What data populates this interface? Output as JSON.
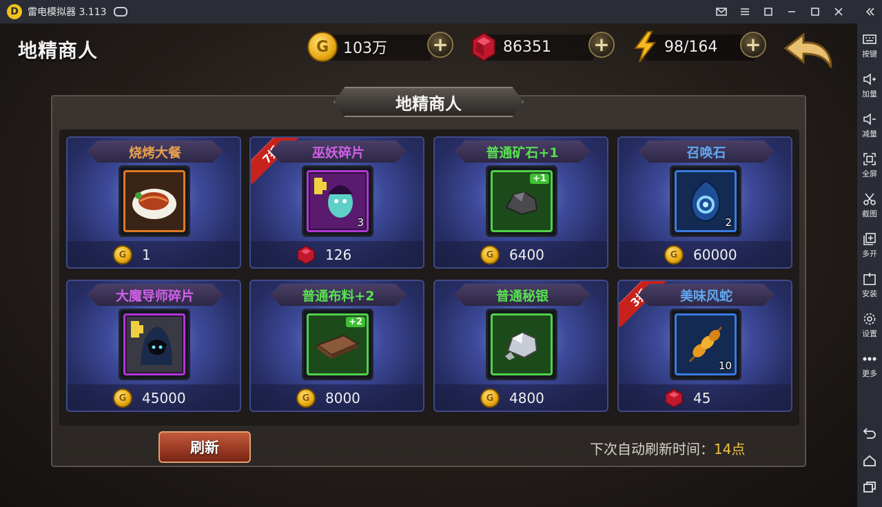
{
  "emulator": {
    "title": "雷电模拟器 3.113",
    "sidebar": [
      {
        "label": "按键",
        "icon": "keyboard-icon"
      },
      {
        "label": "加量",
        "icon": "volume-up-icon"
      },
      {
        "label": "减量",
        "icon": "volume-down-icon"
      },
      {
        "label": "全屏",
        "icon": "fullscreen-icon"
      },
      {
        "label": "截图",
        "icon": "scissors-icon"
      },
      {
        "label": "多开",
        "icon": "multi-open-icon"
      },
      {
        "label": "安装",
        "icon": "apk-install-icon"
      },
      {
        "label": "设置",
        "icon": "gear-icon"
      },
      {
        "label": "更多",
        "icon": "more-icon"
      }
    ]
  },
  "game": {
    "page_title": "地精商人",
    "resources": {
      "gold": "103万",
      "gems": "86351",
      "energy": "98/164"
    },
    "panel_title": "地精商人",
    "items": [
      {
        "name": "烧烤大餐",
        "name_color": "#e8a050",
        "frame": "orange",
        "price": "1",
        "currency": "gold",
        "qty": "",
        "plus": "",
        "discount": ""
      },
      {
        "name": "巫妖碎片",
        "name_color": "#d060e8",
        "frame": "purple",
        "price": "126",
        "currency": "gem",
        "qty": "3",
        "plus": "",
        "discount": "7折"
      },
      {
        "name": "普通矿石+1",
        "name_color": "#58e050",
        "frame": "green",
        "price": "6400",
        "currency": "gold",
        "qty": "",
        "plus": "+1",
        "discount": ""
      },
      {
        "name": "召唤石",
        "name_color": "#60a8f0",
        "frame": "blue",
        "price": "60000",
        "currency": "gold",
        "qty": "2",
        "plus": "",
        "discount": ""
      },
      {
        "name": "大魔导师碎片",
        "name_color": "#d060e8",
        "frame": "purple",
        "price": "45000",
        "currency": "gold",
        "qty": "",
        "plus": "",
        "discount": ""
      },
      {
        "name": "普通布料+2",
        "name_color": "#58e050",
        "frame": "green",
        "price": "8000",
        "currency": "gold",
        "qty": "",
        "plus": "+2",
        "discount": ""
      },
      {
        "name": "普通秘银",
        "name_color": "#58e050",
        "frame": "green",
        "price": "4800",
        "currency": "gold",
        "qty": "",
        "plus": "",
        "discount": ""
      },
      {
        "name": "美味风蛇",
        "name_color": "#60a8f0",
        "frame": "blue",
        "price": "45",
        "currency": "gem",
        "qty": "10",
        "plus": "",
        "discount": "3折"
      }
    ],
    "refresh_label": "刷新",
    "auto_refresh_label": "下次自动刷新时间：",
    "auto_refresh_hour": "14点"
  }
}
